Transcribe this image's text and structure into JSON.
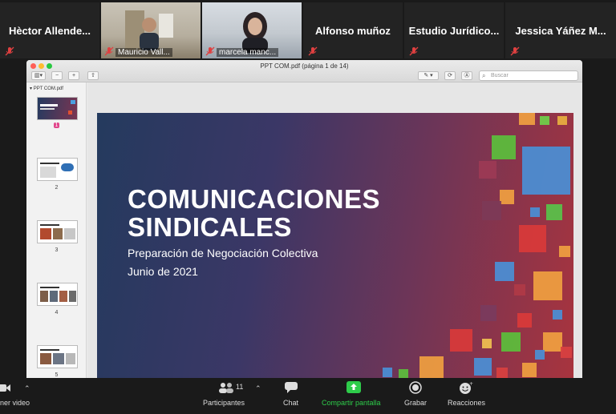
{
  "participants": [
    {
      "name": "Hèctor Allende...",
      "video": false
    },
    {
      "name": "Mauricio Vall...",
      "video": true
    },
    {
      "name": "marcela manc...",
      "video": true
    },
    {
      "name": "Alfonso muñoz",
      "video": false
    },
    {
      "name": "Estudio Jurídico...",
      "video": false
    },
    {
      "name": "Jessica Yáñez M...",
      "video": false
    }
  ],
  "viewer": {
    "window_title": "PPT COM.pdf (página 1 de 14)",
    "search_placeholder": "Buscar",
    "sidebar_header": "PPT COM.pdf",
    "pages": [
      "1",
      "2",
      "3",
      "4",
      "5"
    ]
  },
  "slide": {
    "title_line1": "COMUNICACIONES",
    "title_line2": "SINDICALES",
    "subtitle": "Preparación de Negociación Colectiva",
    "date": "Junio de 2021",
    "colors": {
      "bg_start": "#243a5e",
      "bg_end": "#a8343e"
    }
  },
  "toolbar": {
    "video_label": "ner video",
    "participants_label": "Participantes",
    "participants_count": "11",
    "chat_label": "Chat",
    "share_label": "Compartir pantalla",
    "record_label": "Grabar",
    "reactions_label": "Reacciones",
    "share_color": "#2ecc4a"
  }
}
